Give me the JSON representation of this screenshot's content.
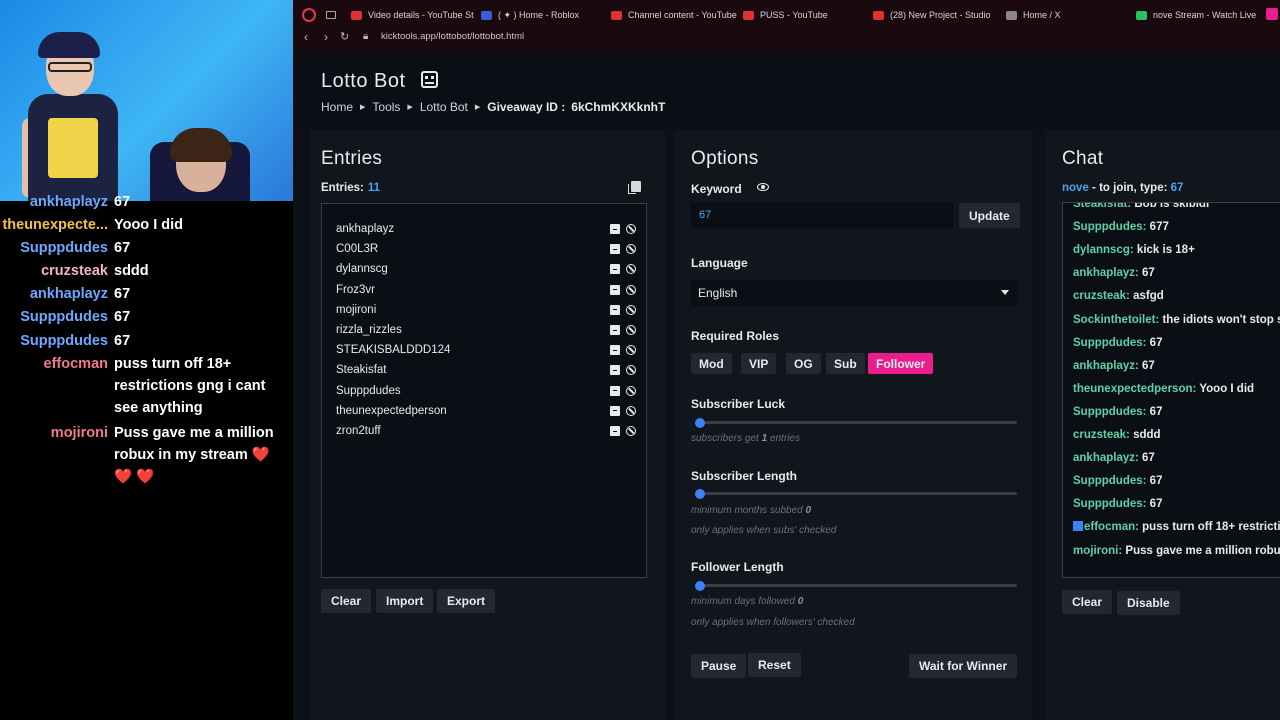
{
  "stream_chat": [
    {
      "user": "ankhaplayz",
      "text": "67",
      "color": "#6ea8ff"
    },
    {
      "user": "theunexpecte...",
      "text": "Yooo I did",
      "color": "#f2c24a"
    },
    {
      "user": "Supppdudes",
      "text": "67",
      "color": "#6ea8ff"
    },
    {
      "user": "cruzsteak",
      "text": "sddd",
      "color": "#f0b6c8"
    },
    {
      "user": "ankhaplayz",
      "text": "67",
      "color": "#6ea8ff"
    },
    {
      "user": "Supppdudes",
      "text": "67",
      "color": "#6ea8ff"
    },
    {
      "user": "Supppdudes",
      "text": "67",
      "color": "#6ea8ff"
    },
    {
      "user": "effocman",
      "text": "puss turn off 18+ restrictions gng i cant see anything",
      "color": "#f07a8a"
    },
    {
      "user": "mojironi",
      "text": "Puss gave me a million robux in my stream ❤️ ❤️ ❤️",
      "color": "#f07a8a"
    }
  ],
  "tabs": [
    {
      "label": "Video details - YouTube St",
      "icon_color": "#d33"
    },
    {
      "label": "( ✦ ) Home - Roblox",
      "icon_color": "#3b5bdb"
    },
    {
      "label": "Channel content - YouTube",
      "icon_color": "#d33"
    },
    {
      "label": "PUSS - YouTube",
      "icon_color": "#d33"
    },
    {
      "label": "(28) New Project - Studio",
      "icon_color": "#e03131"
    },
    {
      "label": "Home / X",
      "icon_color": "#888"
    },
    {
      "label": "nove Stream - Watch Live",
      "icon_color": "#22c55e"
    }
  ],
  "nav": {
    "url": "kicktools.app/lottobot/lottobot.html"
  },
  "header": {
    "title": "Lotto Bot",
    "breadcrumb": [
      "Home",
      "Tools",
      "Lotto Bot"
    ],
    "giveaway_label": "Giveaway ID :",
    "giveaway_id": "6kChmKXKknhT"
  },
  "entries": {
    "title": "Entries",
    "count_label": "Entries:",
    "count": "11",
    "list": [
      "ankhaplayz",
      "C00L3R",
      "dylannscg",
      "Froz3vr",
      "mojironi",
      "rizzla_rizzles",
      "STEAKISBALDDD124",
      "Steakisfat",
      "Supppdudes",
      "theunexpectedperson",
      "zron2tuff"
    ],
    "buttons": {
      "clear": "Clear",
      "import": "Import",
      "export": "Export"
    }
  },
  "options": {
    "title": "Options",
    "keyword_label": "Keyword",
    "keyword_value": "67",
    "update_label": "Update",
    "language_label": "Language",
    "language_value": "English",
    "roles_label": "Required Roles",
    "roles": [
      {
        "label": "Mod",
        "active": false
      },
      {
        "label": "VIP",
        "active": false
      },
      {
        "label": "OG",
        "active": false
      },
      {
        "label": "Sub",
        "active": false
      },
      {
        "label": "Follower",
        "active": true
      }
    ],
    "sub_luck": {
      "label": "Subscriber Luck",
      "hint_pre": "subscribers get",
      "value": "1",
      "hint_post": "entries",
      "level": 0
    },
    "sub_length": {
      "label": "Subscriber Length",
      "hint_pre": "minimum months subbed",
      "value": "0",
      "note": "only applies when subs' checked",
      "level": 0
    },
    "follower_length": {
      "label": "Follower Length",
      "hint_pre": "minimum days followed",
      "value": "0",
      "note": "only applies when followers' checked",
      "level": 0
    },
    "buttons": {
      "pause": "Pause",
      "reset": "Reset",
      "wait": "Wait for Winner"
    }
  },
  "chat": {
    "title": "Chat",
    "channel": "nove",
    "instruction": "- to join, type:",
    "code": "67",
    "messages": [
      {
        "user": "Steakisfat:",
        "text": "Bob is skibidi"
      },
      {
        "user": "Supppdudes:",
        "text": "677"
      },
      {
        "user": "dylannscg:",
        "text": "kick is 18+"
      },
      {
        "user": "ankhaplayz:",
        "text": "67"
      },
      {
        "user": "cruzsteak:",
        "text": "asfgd"
      },
      {
        "user": "Sockinthetoilet:",
        "text": "the idiots won't stop s"
      },
      {
        "user": "Supppdudes:",
        "text": "67"
      },
      {
        "user": "ankhaplayz:",
        "text": "67"
      },
      {
        "user": "theunexpectedperson:",
        "text": "Yooo I did"
      },
      {
        "user": "Supppdudes:",
        "text": "67"
      },
      {
        "user": "cruzsteak:",
        "text": "sddd"
      },
      {
        "user": "ankhaplayz:",
        "text": "67"
      },
      {
        "user": "Supppdudes:",
        "text": "67"
      },
      {
        "user": "Supppdudes:",
        "text": "67"
      },
      {
        "user": "effocman:",
        "text": "puss turn off 18+ restricti",
        "badge": true
      },
      {
        "user": "mojironi:",
        "text": "Puss gave me a million robu"
      }
    ],
    "buttons": {
      "clear": "Clear",
      "disable": "Disable"
    }
  }
}
